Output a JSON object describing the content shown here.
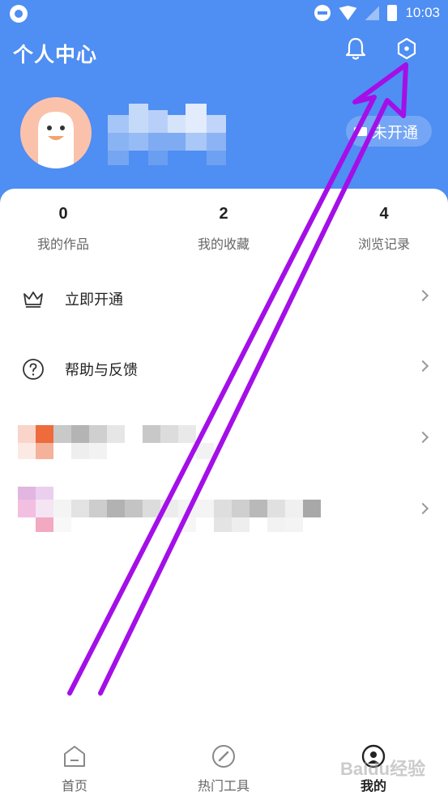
{
  "status_bar": {
    "time": "10:03",
    "icons": [
      "app-icon",
      "dnd-icon",
      "wifi-icon",
      "signal-icon",
      "battery-icon"
    ]
  },
  "header": {
    "title": "个人中心",
    "bell_icon": "bell-icon",
    "settings_icon": "hexagon-settings-icon",
    "vip_badge_label": "未开通",
    "background_color": "#4f8ef2"
  },
  "stats": [
    {
      "value": "0",
      "label": "我的作品"
    },
    {
      "value": "2",
      "label": "我的收藏"
    },
    {
      "value": "4",
      "label": "浏览记录"
    }
  ],
  "menu": [
    {
      "label": "立即开通",
      "icon": "crown-icon"
    },
    {
      "label": "帮助与反馈",
      "icon": "question-circle-icon"
    }
  ],
  "tabbar": {
    "tabs": [
      {
        "label": "首页",
        "icon": "home-icon",
        "active": false
      },
      {
        "label": "热门工具",
        "icon": "compass-icon",
        "active": false
      },
      {
        "label": "我的",
        "icon": "profile-icon",
        "active": true
      }
    ]
  },
  "watermark": "Baidu经验",
  "annotation_color": "#a40fe8"
}
